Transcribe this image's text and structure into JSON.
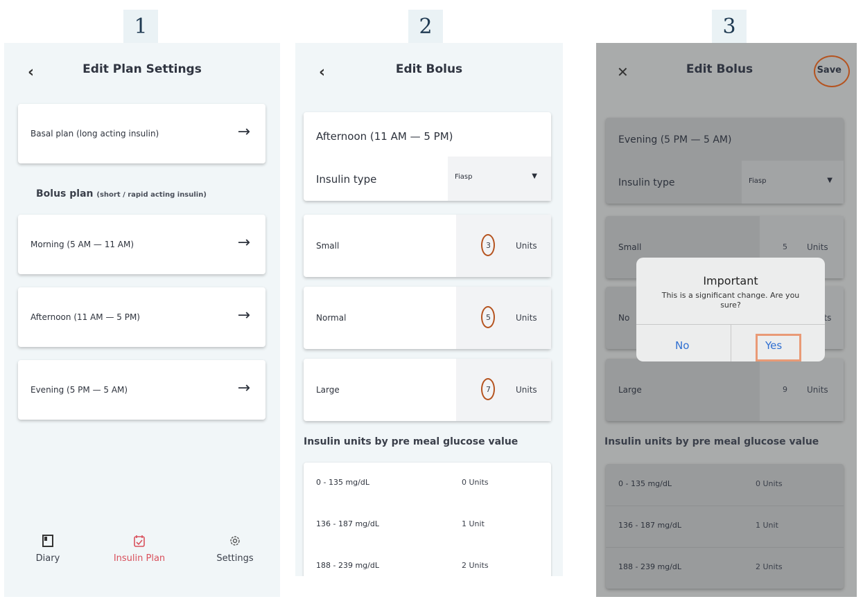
{
  "steps": [
    "1",
    "2",
    "3"
  ],
  "screen1": {
    "back_icon": "‹",
    "title": "Edit Plan Settings",
    "basal_label": "Basal plan (long acting insulin)",
    "arrow": "→",
    "bolus_heading": "Bolus plan",
    "bolus_sub": "(short / rapid acting insulin)",
    "bolus_items": [
      "Morning (5 AM — 11 AM)",
      "Afternoon (11 AM — 5 PM)",
      "Evening (5 PM — 5 AM)"
    ],
    "nav": {
      "diary": "Diary",
      "insulin_plan": "Insulin Plan",
      "settings": "Settings"
    }
  },
  "screen2": {
    "back_icon": "‹",
    "title": "Edit Bolus",
    "period": "Afternoon (11 AM — 5 PM)",
    "insulin_type_label": "Insulin type",
    "insulin_type_value": "Fiasp",
    "sizes": [
      {
        "label": "Small",
        "value": "3",
        "units": "Units"
      },
      {
        "label": "Normal",
        "value": "5",
        "units": "Units"
      },
      {
        "label": "Large",
        "value": "7",
        "units": "Units"
      }
    ],
    "glucose_heading": "Insulin units by pre meal glucose value",
    "glucose_rows": [
      {
        "range": "0 - 135 mg/dL",
        "units": "0 Units"
      },
      {
        "range": "136 - 187 mg/dL",
        "units": "1 Unit"
      },
      {
        "range": "188 - 239 mg/dL",
        "units": "2 Units"
      }
    ]
  },
  "screen3": {
    "close_icon": "✕",
    "title": "Edit Bolus",
    "save_label": "Save",
    "period": "Evening (5 PM — 5 AM)",
    "insulin_type_label": "Insulin type",
    "insulin_type_value": "Fiasp",
    "sizes": [
      {
        "label": "Small",
        "value": "5",
        "units": "Units"
      },
      {
        "label": "No",
        "value": "",
        "units": "Jnits"
      },
      {
        "label": "Large",
        "value": "9",
        "units": "Units"
      }
    ],
    "glucose_heading": "Insulin units by pre meal glucose value",
    "glucose_rows": [
      {
        "range": "0 - 135 mg/dL",
        "units": "0 Units"
      },
      {
        "range": "136 - 187 mg/dL",
        "units": "1 Unit"
      },
      {
        "range": "188 - 239 mg/dL",
        "units": "2 Units"
      }
    ],
    "dialog": {
      "title": "Important",
      "message": "This is a significant change. Are you sure?",
      "no_label": "No",
      "yes_label": "Yes"
    }
  },
  "colors": {
    "accent": "#d9505c",
    "highlight": "#b5531f",
    "dialog_button": "#2f6fd1"
  }
}
